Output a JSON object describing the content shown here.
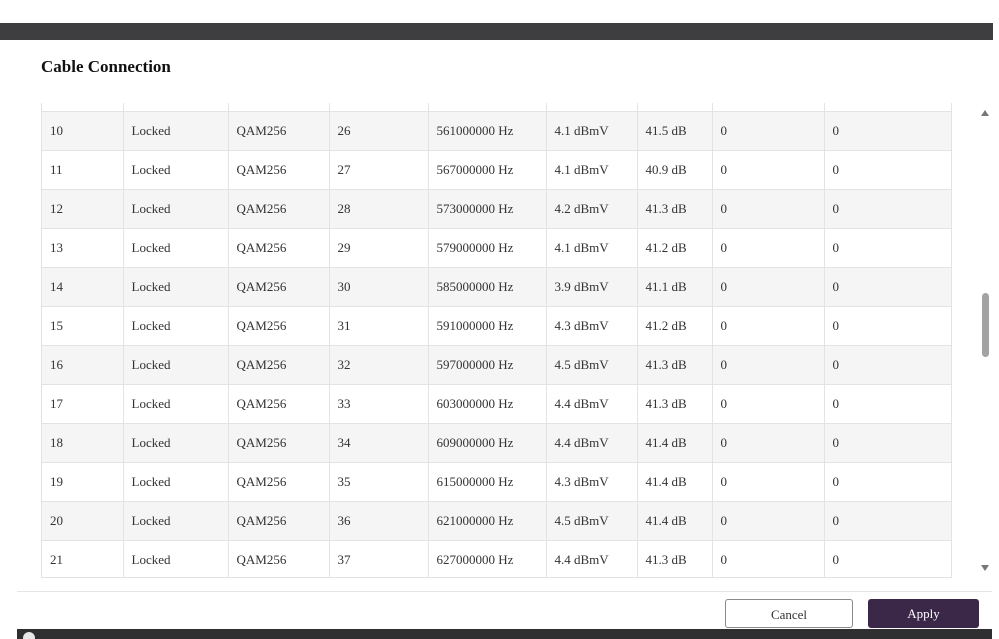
{
  "modal": {
    "title": "Cable Connection"
  },
  "table": {
    "rows": [
      [
        "10",
        "Locked",
        "QAM256",
        "26",
        "561000000 Hz",
        "4.1 dBmV",
        "41.5 dB",
        "0",
        "0"
      ],
      [
        "11",
        "Locked",
        "QAM256",
        "27",
        "567000000 Hz",
        "4.1 dBmV",
        "40.9 dB",
        "0",
        "0"
      ],
      [
        "12",
        "Locked",
        "QAM256",
        "28",
        "573000000 Hz",
        "4.2 dBmV",
        "41.3 dB",
        "0",
        "0"
      ],
      [
        "13",
        "Locked",
        "QAM256",
        "29",
        "579000000 Hz",
        "4.1 dBmV",
        "41.2 dB",
        "0",
        "0"
      ],
      [
        "14",
        "Locked",
        "QAM256",
        "30",
        "585000000 Hz",
        "3.9 dBmV",
        "41.1 dB",
        "0",
        "0"
      ],
      [
        "15",
        "Locked",
        "QAM256",
        "31",
        "591000000 Hz",
        "4.3 dBmV",
        "41.2 dB",
        "0",
        "0"
      ],
      [
        "16",
        "Locked",
        "QAM256",
        "32",
        "597000000 Hz",
        "4.5 dBmV",
        "41.3 dB",
        "0",
        "0"
      ],
      [
        "17",
        "Locked",
        "QAM256",
        "33",
        "603000000 Hz",
        "4.4 dBmV",
        "41.3 dB",
        "0",
        "0"
      ],
      [
        "18",
        "Locked",
        "QAM256",
        "34",
        "609000000 Hz",
        "4.4 dBmV",
        "41.4 dB",
        "0",
        "0"
      ],
      [
        "19",
        "Locked",
        "QAM256",
        "35",
        "615000000 Hz",
        "4.3 dBmV",
        "41.4 dB",
        "0",
        "0"
      ],
      [
        "20",
        "Locked",
        "QAM256",
        "36",
        "621000000 Hz",
        "4.5 dBmV",
        "41.4 dB",
        "0",
        "0"
      ],
      [
        "21",
        "Locked",
        "QAM256",
        "37",
        "627000000 Hz",
        "4.4 dBmV",
        "41.3 dB",
        "0",
        "0"
      ]
    ]
  },
  "buttons": {
    "cancel": "Cancel",
    "apply": "Apply"
  },
  "colors": {
    "topbar": "#3e3e40",
    "apply_bg": "#3b2748",
    "row_alt": "#f5f5f5"
  },
  "icons": {
    "scroll_up": "triangle-up",
    "scroll_down": "triangle-down",
    "help": "help-circle-icon"
  }
}
